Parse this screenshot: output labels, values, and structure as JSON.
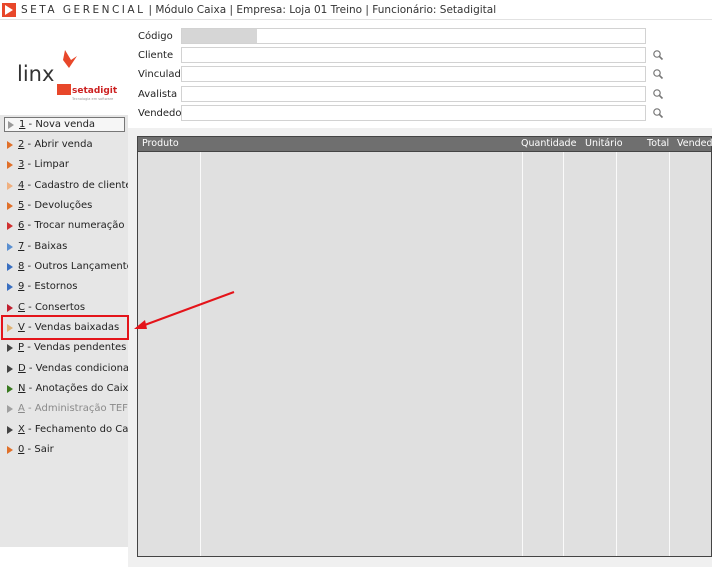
{
  "titlebar": {
    "app_name": "SETA GERENCIAL",
    "rest": "| Módulo Caixa | Empresa: Loja 01 Treino | Funcionário: Setadigital"
  },
  "logo": {
    "brand": "Linx",
    "sub": "setadigital",
    "tagline": "Tecnologia em software"
  },
  "form": {
    "codigo_label": "Código",
    "cliente_label": "Cliente",
    "vinculada_label": "Vinculada",
    "avalista_label": "Avalista",
    "vendedor_label": "Vendedor"
  },
  "menu": {
    "items": [
      {
        "key": "1",
        "text": " - Nova venda",
        "color": "#9a9a9a"
      },
      {
        "key": "2",
        "text": " - Abrir venda",
        "color": "#e0702a"
      },
      {
        "key": "3",
        "text": " - Limpar",
        "color": "#e0702a"
      },
      {
        "key": "4",
        "text": " - Cadastro de clientes",
        "color": "#f0b080"
      },
      {
        "key": "5",
        "text": " - Devoluções",
        "color": "#e0702a"
      },
      {
        "key": "6",
        "text": " - Trocar numeração",
        "color": "#d03030"
      },
      {
        "key": "7",
        "text": " - Baixas",
        "color": "#5a8fd0"
      },
      {
        "key": "8",
        "text": " - Outros Lançamentos",
        "color": "#3a6fc0"
      },
      {
        "key": "9",
        "text": " - Estornos",
        "color": "#3a6fc0"
      },
      {
        "key": "C",
        "text": " - Consertos",
        "color": "#c02030"
      },
      {
        "key": "V",
        "text": " - Vendas baixadas",
        "color": "#e0b070"
      },
      {
        "key": "P",
        "text": " - Vendas pendentes",
        "color": "#444444"
      },
      {
        "key": "D",
        "text": " - Vendas condicionais",
        "color": "#444444"
      },
      {
        "key": "N",
        "text": " - Anotações do Caixa",
        "color": "#3a7a20"
      },
      {
        "key": "A",
        "text": " - Administração TEF",
        "color": "#a0a0a0"
      },
      {
        "key": "X",
        "text": " - Fechamento do Caixa",
        "color": "#444444"
      },
      {
        "key": "0",
        "text": " - Sair",
        "color": "#e0702a"
      }
    ]
  },
  "grid": {
    "columns": [
      "Produto",
      "Quantidade",
      "Unitário",
      "Total",
      "Vendedo"
    ]
  }
}
